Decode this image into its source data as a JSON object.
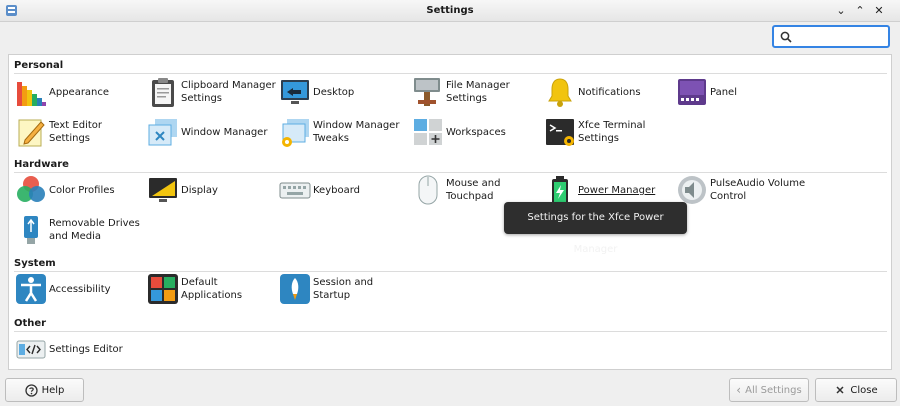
{
  "window": {
    "title": "Settings",
    "minimize": "⌄",
    "maximize": "⌃",
    "close": "✕"
  },
  "search": {
    "placeholder": "",
    "value": ""
  },
  "sections": {
    "personal": "Personal",
    "hardware": "Hardware",
    "system": "System",
    "other": "Other"
  },
  "items": {
    "appearance": "Appearance",
    "clipboard": "Clipboard Manager Settings",
    "desktop": "Desktop",
    "file_manager": "File Manager Settings",
    "notifications": "Notifications",
    "panel": "Panel",
    "text_editor": "Text Editor Settings",
    "window_manager": "Window Manager",
    "wm_tweaks": "Window Manager Tweaks",
    "workspaces": "Workspaces",
    "terminal": "Xfce Terminal Settings",
    "color_profiles": "Color Profiles",
    "display": "Display",
    "keyboard": "Keyboard",
    "mouse": "Mouse and Touchpad",
    "power": "Power Manager",
    "pulseaudio": "PulseAudio Volume Control",
    "removable": "Removable Drives and Media",
    "accessibility": "Accessibility",
    "default_apps": "Default Applications",
    "session": "Session and Startup",
    "settings_editor": "Settings Editor"
  },
  "tooltip": "Settings for the Xfce Power Manager",
  "buttons": {
    "help": "Help",
    "all_settings": "All Settings",
    "close": "Close"
  },
  "colors": {
    "accent": "#3584e4",
    "tooltip_bg": "#2e2e2e"
  }
}
